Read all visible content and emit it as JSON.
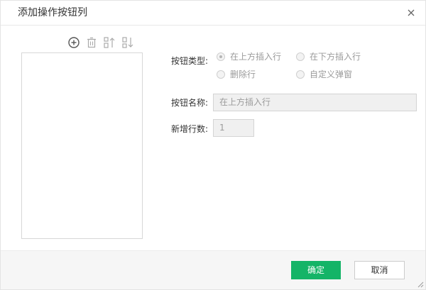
{
  "dialog": {
    "title": "添加操作按钮列"
  },
  "toolbar": {
    "icons": [
      "add-icon",
      "delete-icon",
      "move-up-icon",
      "move-down-icon"
    ]
  },
  "form": {
    "button_type_label": "按钮类型:",
    "button_type_options": [
      {
        "label": "在上方插入行",
        "checked": true
      },
      {
        "label": "在下方插入行",
        "checked": false
      },
      {
        "label": "删除行",
        "checked": false
      },
      {
        "label": "自定义弹窗",
        "checked": false
      }
    ],
    "button_name_label": "按钮名称:",
    "button_name_value": "在上方插入行",
    "new_rows_label": "新增行数:",
    "new_rows_value": "1"
  },
  "footer": {
    "ok_label": "确定",
    "cancel_label": "取消"
  },
  "colors": {
    "primary": "#14b467",
    "disabled_text": "#9b9b9b",
    "disabled_bg": "#f0f0f0"
  }
}
